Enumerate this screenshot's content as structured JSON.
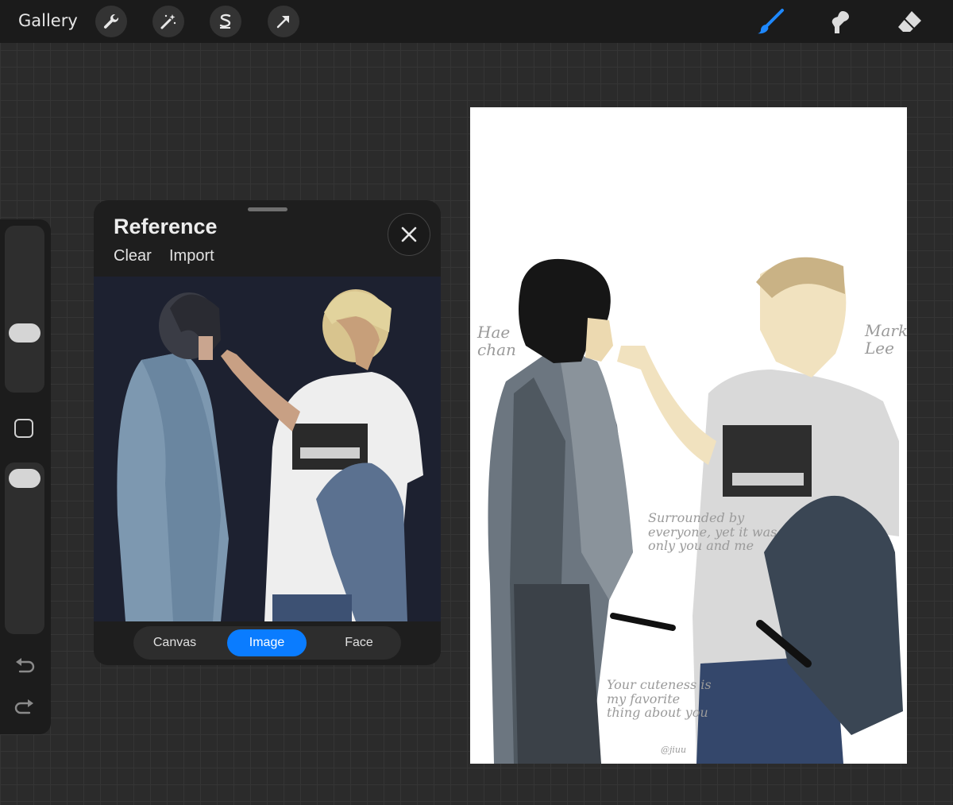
{
  "topbar": {
    "gallery_label": "Gallery",
    "left_tools": [
      "wrench-icon",
      "magic-wand-icon",
      "selection-icon",
      "transform-arrow-icon"
    ],
    "right_tools": [
      "brush-icon",
      "smudge-icon",
      "eraser-icon"
    ],
    "active_color": "#1e88ff"
  },
  "reference": {
    "title": "Reference",
    "clear_label": "Clear",
    "import_label": "Import",
    "modes": [
      "Canvas",
      "Image",
      "Face"
    ],
    "active_mode": "Image"
  },
  "canvas": {
    "left_name": "Hae\nchan",
    "right_name": "Mark\nLee",
    "caption_middle": "Surrounded by\neveryone, yet it was\nonly you and me",
    "caption_bottom": "Your cuteness is\nmy favorite\nthing about you",
    "signature": "@jiuu"
  }
}
